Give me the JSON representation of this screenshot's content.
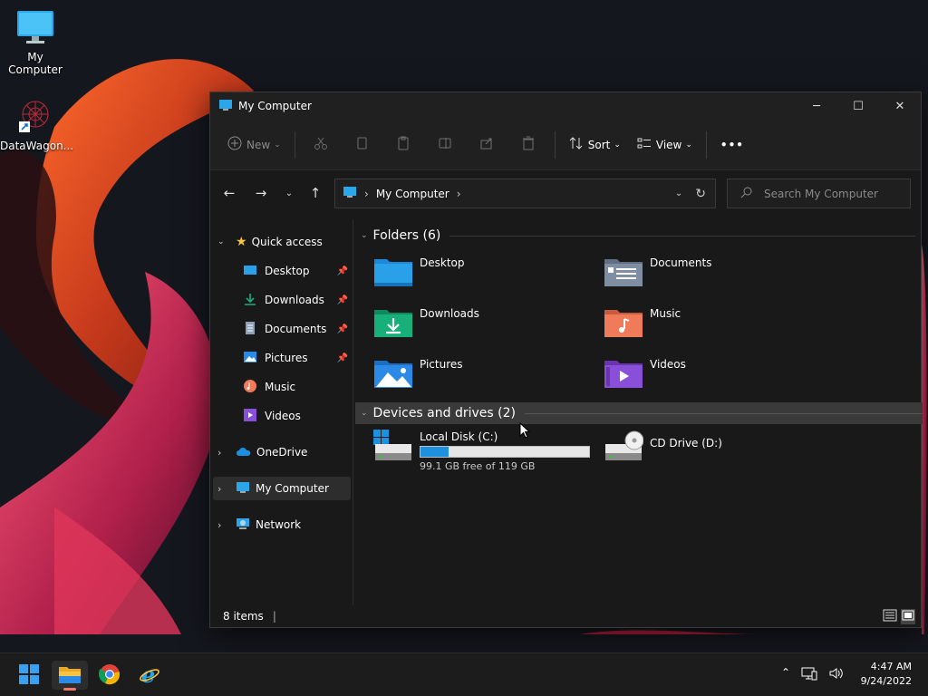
{
  "desktop": {
    "icons": [
      {
        "label": "My Computer",
        "icon": "monitor-icon"
      },
      {
        "label": "DataWagon...",
        "icon": "datawagon-shortcut-icon"
      }
    ]
  },
  "window": {
    "title": "My Computer",
    "controls": {
      "minimize": "─",
      "maximize": "☐",
      "close": "✕"
    },
    "toolbar": {
      "new_label": "New",
      "sort_label": "Sort",
      "view_label": "View",
      "more_label": "•••"
    },
    "address": {
      "location": "My Computer",
      "search_placeholder": "Search My Computer"
    },
    "sidebar": {
      "quick_access": "Quick access",
      "items": [
        {
          "label": "Desktop",
          "pinned": true
        },
        {
          "label": "Downloads",
          "pinned": true
        },
        {
          "label": "Documents",
          "pinned": true
        },
        {
          "label": "Pictures",
          "pinned": true
        },
        {
          "label": "Music",
          "pinned": false
        },
        {
          "label": "Videos",
          "pinned": false
        }
      ],
      "onedrive": "OneDrive",
      "my_computer": "My Computer",
      "network": "Network"
    },
    "main": {
      "folders_header": "Folders (6)",
      "folders": [
        {
          "label": "Desktop",
          "color": "#2aa0e8"
        },
        {
          "label": "Documents",
          "color": "#7f8ea3"
        },
        {
          "label": "Downloads",
          "color": "#17b07a"
        },
        {
          "label": "Music",
          "color": "#f07b5a"
        },
        {
          "label": "Pictures",
          "color": "#2a8ae6"
        },
        {
          "label": "Videos",
          "color": "#8a4fd8"
        }
      ],
      "devices_header": "Devices and drives (2)",
      "drives": [
        {
          "label": "Local Disk (C:)",
          "free_text": "99.1 GB free of 119 GB",
          "used_fraction": 0.167
        },
        {
          "label": "CD Drive (D:)"
        }
      ]
    },
    "status": {
      "items_text": "8 items"
    }
  },
  "taskbar": {
    "time": "4:47 AM",
    "date": "9/24/2022",
    "apps": [
      "start-icon",
      "file-explorer-icon",
      "chrome-icon",
      "internet-explorer-icon"
    ]
  },
  "colors": {
    "accent": "#1e90e0",
    "window_bg": "#191919",
    "selected_bg": "#2d2d2d"
  }
}
